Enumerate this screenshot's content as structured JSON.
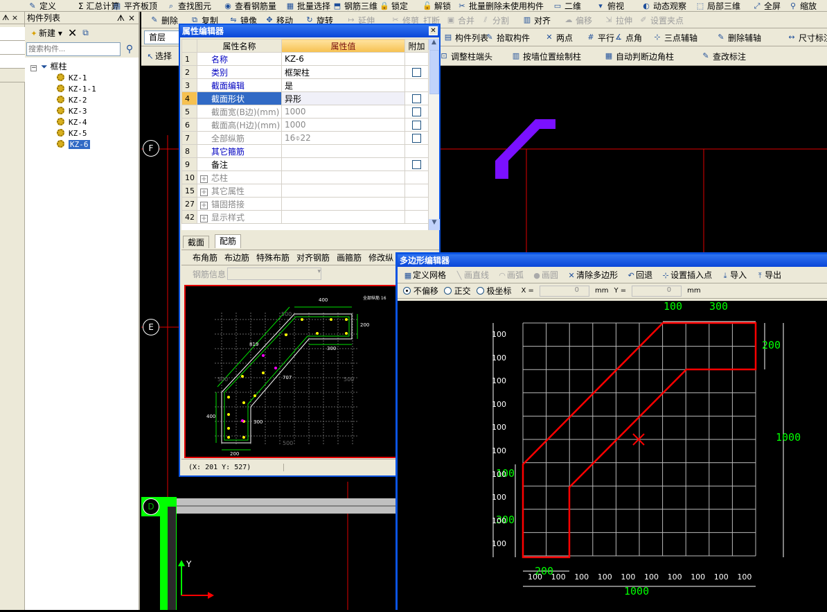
{
  "top_toolbar": {
    "items": [
      "定义",
      "Σ 汇总计算",
      "平齐板顶",
      "查找图元",
      "查看钢筋量",
      "批量选择",
      "钢筋三维",
      "锁定",
      "解锁",
      "批量删除未使用构件",
      "二维",
      "俯视",
      "动态观察",
      "局部三维",
      "全屏",
      "缩放"
    ]
  },
  "second_toolbar": {
    "items": [
      "删除",
      "复制",
      "镜像",
      "移动",
      "旋转",
      "延伸",
      "修剪",
      "打断",
      "合并",
      "分割",
      "对齐",
      "偏移",
      "拉伸",
      "设置夹点"
    ]
  },
  "third_toolbar": {
    "floor": "首层",
    "items": [
      "构件列表",
      "拾取构件",
      "两点",
      "平行",
      "点角",
      "三点辅轴",
      "删除辅轴",
      "尺寸标注"
    ]
  },
  "fourth_toolbar": {
    "select": "选择",
    "items": [
      "调整柱端头",
      "按墙位置绘制柱",
      "自动判断边角柱",
      "查改标注"
    ]
  },
  "left_panel": {
    "title": "构件列表",
    "pin": "ᗑ",
    "close": "×"
  },
  "component_list": {
    "title": "构件列表",
    "new_label": "新建",
    "search_placeholder": "搜索构件...",
    "root": "框柱",
    "items": [
      "KZ-1",
      "KZ-1-1",
      "KZ-2",
      "KZ-3",
      "KZ-4",
      "KZ-5",
      "KZ-6"
    ],
    "selected": "KZ-6"
  },
  "property_editor": {
    "title": "属性编辑器",
    "headers": [
      "属性名称",
      "属性值",
      "附加"
    ],
    "rows": [
      {
        "n": "1",
        "name": "名称",
        "value": "KZ-6",
        "check": false,
        "style": "blue"
      },
      {
        "n": "2",
        "name": "类别",
        "value": "框架柱",
        "check": true,
        "style": "blue"
      },
      {
        "n": "3",
        "name": "截面编辑",
        "value": "是",
        "check": false,
        "style": "blue"
      },
      {
        "n": "4",
        "name": "截面形状",
        "value": "异形",
        "check": true,
        "style": "sel"
      },
      {
        "n": "5",
        "name": "截面宽(B边)(mm)",
        "value": "1000",
        "check": true,
        "style": "gray"
      },
      {
        "n": "6",
        "name": "截面高(H边)(mm)",
        "value": "1000",
        "check": true,
        "style": "gray"
      },
      {
        "n": "7",
        "name": "全部纵筋",
        "value": "16⌽22",
        "check": true,
        "style": "gray"
      },
      {
        "n": "8",
        "name": "其它箍筋",
        "value": "",
        "check": false,
        "style": "blue"
      },
      {
        "n": "9",
        "name": "备注",
        "value": "",
        "check": true,
        "style": "black"
      },
      {
        "n": "10",
        "name": "芯柱",
        "value": "",
        "check": false,
        "style": "expand"
      },
      {
        "n": "15",
        "name": "其它属性",
        "value": "",
        "check": false,
        "style": "expand"
      },
      {
        "n": "27",
        "name": "锚固搭接",
        "value": "",
        "check": false,
        "style": "expand"
      },
      {
        "n": "42",
        "name": "显示样式",
        "value": "",
        "check": false,
        "style": "expand"
      }
    ],
    "tabs": [
      "截面",
      "配筋"
    ],
    "active_tab": "配筋",
    "rebar_toolbar": [
      "布角筋",
      "布边筋",
      "特殊布筋",
      "对齐钢筋",
      "画箍筋",
      "修改纵"
    ],
    "rebar_info_label": "钢筋信息",
    "status": "(X: 201 Y: 527)",
    "preview_labels": {
      "top": "400",
      "right": "200",
      "inner_right": "300",
      "diag1": "819",
      "diag2": "707",
      "left": "400",
      "left_bottom": "300",
      "bottom": "200",
      "top_grid": "500",
      "left_grid": "500",
      "right_grid": "500",
      "bottom_grid": "500",
      "note": "全部纵筋 16"
    }
  },
  "polygon_editor": {
    "title": "多边形编辑器",
    "toolbar": [
      "定义网格",
      "画直线",
      "画弧",
      "画圆",
      "清除多边形",
      "回退",
      "设置插入点",
      "导入",
      "导出"
    ],
    "options": {
      "no_offset": "不偏移",
      "ortho": "正交",
      "polar": "极坐标",
      "x_label": "X =",
      "x_val": "0",
      "y_label": "Y =",
      "y_val": "0",
      "unit": "mm"
    },
    "grid_labels": [
      "100",
      "100",
      "100",
      "100",
      "100",
      "100",
      "100",
      "100",
      "100",
      "100"
    ],
    "dims": {
      "top_left": "100",
      "top_right": "300",
      "right": "200",
      "total_h": "1000",
      "left_a": "100",
      "left_b": "300",
      "bottom_small": "200",
      "total_w": "1000"
    }
  },
  "canvas": {
    "axes": [
      "F",
      "E",
      "D"
    ],
    "ucs": "Y"
  },
  "colors": {
    "accent": "#0b54e3",
    "red": "#ff0000",
    "green": "#00ff00",
    "purple": "#7a10ff"
  }
}
